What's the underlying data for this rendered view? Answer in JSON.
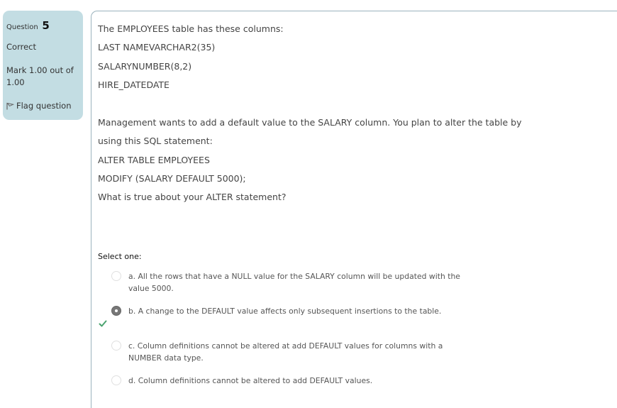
{
  "info": {
    "question_label": "Question",
    "question_number": "5",
    "state": "Correct",
    "grade": "Mark 1.00 out of 1.00",
    "flag_label": "Flag question"
  },
  "question": {
    "lines": [
      "The EMPLOYEES table has these columns:",
      "LAST NAMEVARCHAR2(35)",
      "SALARYNUMBER(8,2)",
      "HIRE_DATEDATE",
      "Management wants to add a default value to the SALARY column. You plan to alter the table by",
      "using this SQL statement:",
      "ALTER TABLE EMPLOYEES",
      "MODIFY (SALARY DEFAULT 5000);",
      "What is true about your ALTER statement?"
    ],
    "prompt": "Select one:",
    "options": [
      {
        "text": "a. All the rows that have a NULL value for the SALARY column will be updated with the value 5000.",
        "selected": false
      },
      {
        "text": "b. A change to the DEFAULT value affects only subsequent insertions to the table.",
        "selected": true
      },
      {
        "text": "c. Column definitions cannot be altered at add DEFAULT values for columns with a NUMBER data type.",
        "selected": false
      },
      {
        "text": "d. Column definitions cannot be altered to add DEFAULT values.",
        "selected": false
      }
    ]
  },
  "colors": {
    "info_bg": "#c3dde3",
    "border": "#9bb3bd",
    "correct_check": "#4aa36f"
  }
}
